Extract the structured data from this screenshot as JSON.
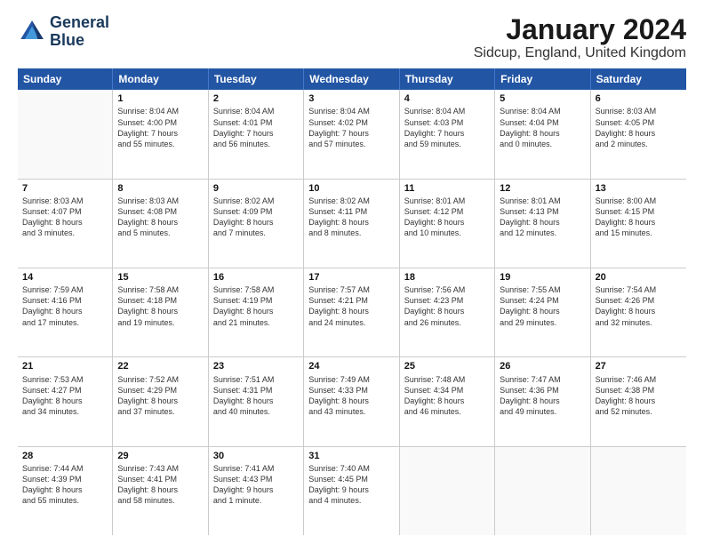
{
  "logo": {
    "line1": "General",
    "line2": "Blue"
  },
  "title": "January 2024",
  "subtitle": "Sidcup, England, United Kingdom",
  "days_of_week": [
    "Sunday",
    "Monday",
    "Tuesday",
    "Wednesday",
    "Thursday",
    "Friday",
    "Saturday"
  ],
  "weeks": [
    [
      {
        "day": "",
        "info": ""
      },
      {
        "day": "1",
        "info": "Sunrise: 8:04 AM\nSunset: 4:00 PM\nDaylight: 7 hours\nand 55 minutes."
      },
      {
        "day": "2",
        "info": "Sunrise: 8:04 AM\nSunset: 4:01 PM\nDaylight: 7 hours\nand 56 minutes."
      },
      {
        "day": "3",
        "info": "Sunrise: 8:04 AM\nSunset: 4:02 PM\nDaylight: 7 hours\nand 57 minutes."
      },
      {
        "day": "4",
        "info": "Sunrise: 8:04 AM\nSunset: 4:03 PM\nDaylight: 7 hours\nand 59 minutes."
      },
      {
        "day": "5",
        "info": "Sunrise: 8:04 AM\nSunset: 4:04 PM\nDaylight: 8 hours\nand 0 minutes."
      },
      {
        "day": "6",
        "info": "Sunrise: 8:03 AM\nSunset: 4:05 PM\nDaylight: 8 hours\nand 2 minutes."
      }
    ],
    [
      {
        "day": "7",
        "info": "Sunrise: 8:03 AM\nSunset: 4:07 PM\nDaylight: 8 hours\nand 3 minutes."
      },
      {
        "day": "8",
        "info": "Sunrise: 8:03 AM\nSunset: 4:08 PM\nDaylight: 8 hours\nand 5 minutes."
      },
      {
        "day": "9",
        "info": "Sunrise: 8:02 AM\nSunset: 4:09 PM\nDaylight: 8 hours\nand 7 minutes."
      },
      {
        "day": "10",
        "info": "Sunrise: 8:02 AM\nSunset: 4:11 PM\nDaylight: 8 hours\nand 8 minutes."
      },
      {
        "day": "11",
        "info": "Sunrise: 8:01 AM\nSunset: 4:12 PM\nDaylight: 8 hours\nand 10 minutes."
      },
      {
        "day": "12",
        "info": "Sunrise: 8:01 AM\nSunset: 4:13 PM\nDaylight: 8 hours\nand 12 minutes."
      },
      {
        "day": "13",
        "info": "Sunrise: 8:00 AM\nSunset: 4:15 PM\nDaylight: 8 hours\nand 15 minutes."
      }
    ],
    [
      {
        "day": "14",
        "info": "Sunrise: 7:59 AM\nSunset: 4:16 PM\nDaylight: 8 hours\nand 17 minutes."
      },
      {
        "day": "15",
        "info": "Sunrise: 7:58 AM\nSunset: 4:18 PM\nDaylight: 8 hours\nand 19 minutes."
      },
      {
        "day": "16",
        "info": "Sunrise: 7:58 AM\nSunset: 4:19 PM\nDaylight: 8 hours\nand 21 minutes."
      },
      {
        "day": "17",
        "info": "Sunrise: 7:57 AM\nSunset: 4:21 PM\nDaylight: 8 hours\nand 24 minutes."
      },
      {
        "day": "18",
        "info": "Sunrise: 7:56 AM\nSunset: 4:23 PM\nDaylight: 8 hours\nand 26 minutes."
      },
      {
        "day": "19",
        "info": "Sunrise: 7:55 AM\nSunset: 4:24 PM\nDaylight: 8 hours\nand 29 minutes."
      },
      {
        "day": "20",
        "info": "Sunrise: 7:54 AM\nSunset: 4:26 PM\nDaylight: 8 hours\nand 32 minutes."
      }
    ],
    [
      {
        "day": "21",
        "info": "Sunrise: 7:53 AM\nSunset: 4:27 PM\nDaylight: 8 hours\nand 34 minutes."
      },
      {
        "day": "22",
        "info": "Sunrise: 7:52 AM\nSunset: 4:29 PM\nDaylight: 8 hours\nand 37 minutes."
      },
      {
        "day": "23",
        "info": "Sunrise: 7:51 AM\nSunset: 4:31 PM\nDaylight: 8 hours\nand 40 minutes."
      },
      {
        "day": "24",
        "info": "Sunrise: 7:49 AM\nSunset: 4:33 PM\nDaylight: 8 hours\nand 43 minutes."
      },
      {
        "day": "25",
        "info": "Sunrise: 7:48 AM\nSunset: 4:34 PM\nDaylight: 8 hours\nand 46 minutes."
      },
      {
        "day": "26",
        "info": "Sunrise: 7:47 AM\nSunset: 4:36 PM\nDaylight: 8 hours\nand 49 minutes."
      },
      {
        "day": "27",
        "info": "Sunrise: 7:46 AM\nSunset: 4:38 PM\nDaylight: 8 hours\nand 52 minutes."
      }
    ],
    [
      {
        "day": "28",
        "info": "Sunrise: 7:44 AM\nSunset: 4:39 PM\nDaylight: 8 hours\nand 55 minutes."
      },
      {
        "day": "29",
        "info": "Sunrise: 7:43 AM\nSunset: 4:41 PM\nDaylight: 8 hours\nand 58 minutes."
      },
      {
        "day": "30",
        "info": "Sunrise: 7:41 AM\nSunset: 4:43 PM\nDaylight: 9 hours\nand 1 minute."
      },
      {
        "day": "31",
        "info": "Sunrise: 7:40 AM\nSunset: 4:45 PM\nDaylight: 9 hours\nand 4 minutes."
      },
      {
        "day": "",
        "info": ""
      },
      {
        "day": "",
        "info": ""
      },
      {
        "day": "",
        "info": ""
      }
    ]
  ]
}
